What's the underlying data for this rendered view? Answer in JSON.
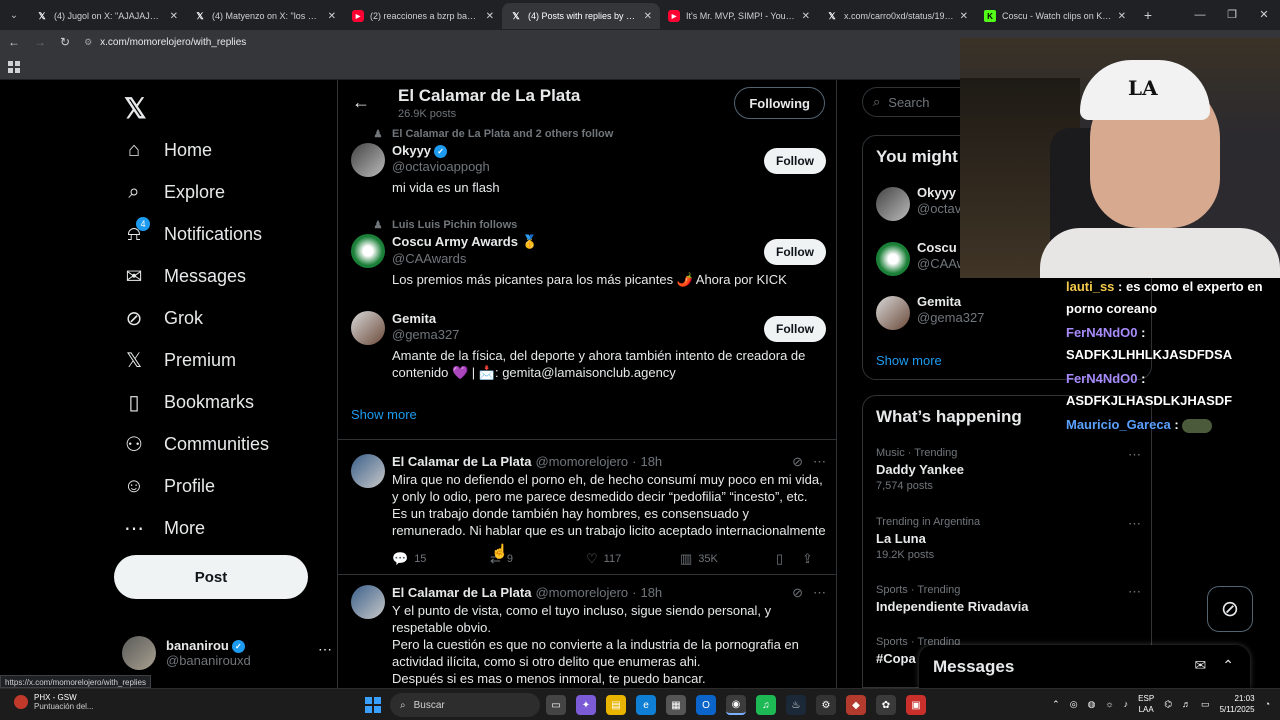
{
  "browser": {
    "tabs": [
      {
        "icon": "x",
        "title": "(4) Jugol on X: \"AJAJAJAJAJA…",
        "active": false
      },
      {
        "icon": "x",
        "title": "(4) Matyenzo on X: \"los nuevos",
        "active": false
      },
      {
        "icon": "yt",
        "title": "(2) reacciones a bzrp bananirou",
        "active": false
      },
      {
        "icon": "x",
        "title": "(4) Posts with replies by El Cala",
        "active": true
      },
      {
        "icon": "yt",
        "title": "It's Mr. MVP, SIMP! - YouTube",
        "active": false
      },
      {
        "icon": "x",
        "title": "x.com/carro0xd/status/198603",
        "active": false
      },
      {
        "icon": "kick",
        "title": "Coscu - Watch clips on Kick",
        "active": false
      }
    ],
    "url": "x.com/momorelojero/with_replies",
    "status_url": "https://x.com/momorelojero/with_replies"
  },
  "sidebar": {
    "nav": [
      {
        "label": "Home",
        "icon": "home-icon",
        "glyph": "⌂"
      },
      {
        "label": "Explore",
        "icon": "search-icon",
        "glyph": "⌕"
      },
      {
        "label": "Notifications",
        "icon": "bell-icon",
        "glyph": "⍾",
        "badge": "4"
      },
      {
        "label": "Messages",
        "icon": "envelope-icon",
        "glyph": "✉"
      },
      {
        "label": "Grok",
        "icon": "grok-icon",
        "glyph": "⊘"
      },
      {
        "label": "Premium",
        "icon": "x-premium-icon",
        "glyph": "𝕏"
      },
      {
        "label": "Bookmarks",
        "icon": "bookmark-icon",
        "glyph": "▯"
      },
      {
        "label": "Communities",
        "icon": "people-icon",
        "glyph": "⚇"
      },
      {
        "label": "Profile",
        "icon": "person-icon",
        "glyph": "☺"
      },
      {
        "label": "More",
        "icon": "more-circle-icon",
        "glyph": "⋯"
      }
    ],
    "post_label": "Post",
    "account": {
      "name": "bananirou",
      "handle": "@bananirouxd"
    }
  },
  "profile_header": {
    "name": "El Calamar de La Plata",
    "posts_count": "26.9K posts",
    "following_label": "Following"
  },
  "suggestions": [
    {
      "context": "El Calamar de La Plata and 2 others follow",
      "name": "Okyyy",
      "verified": true,
      "handle": "@octavioappogh",
      "bio": "mi vida es un flash",
      "follow_label": "Follow"
    },
    {
      "context": "Luis Luis Pichin follows",
      "name": "Coscu Army Awards 🥇",
      "verified": false,
      "handle": "@CAAwards",
      "bio": "Los premios más picantes para los más picantes 🌶️ Ahora por KICK",
      "follow_label": "Follow"
    },
    {
      "context": "",
      "name": "Gemita",
      "verified": false,
      "handle": "@gema327",
      "bio": "Amante de la física, del deporte y ahora también intento de creadora de contenido 💜 | 📩: gemita@lamaisonclub.agency",
      "follow_label": "Follow"
    }
  ],
  "show_more_label": "Show more",
  "tweets": [
    {
      "name": "El Calamar de La Plata",
      "handle": "@momorelojero",
      "time": "18h",
      "text": "Mira que no defiendo el porno eh, de hecho consumí muy poco en mi vida, y only lo odio, pero me parece desmedido decir “pedofilia” “incesto”, etc. Es un trabajo donde también hay hombres, es consensuado y remunerado. Ni hablar que es un trabajo licito aceptado internacionalmente",
      "replies": "15",
      "reposts": "9",
      "likes": "117",
      "views": "35K"
    },
    {
      "name": "El Calamar de La Plata",
      "handle": "@momorelojero",
      "time": "18h",
      "text": "Y el punto de vista, como el tuyo incluso, sigue siendo personal, y respetable obvio.\nPero la cuestión es que no convierte a la industria de la pornografia en actividad ilícita, como si otro delito que enumeras ahi.\nDespués si es mas o menos inmoral, te puedo bancar."
    }
  ],
  "right": {
    "search_placeholder": "Search",
    "who_to_follow_title": "You might like",
    "who_to_follow": [
      {
        "name": "Okyyy",
        "handle": "@octavioappogh"
      },
      {
        "name": "Coscu Army Awards",
        "handle": "@CAAwards"
      },
      {
        "name": "Gemita",
        "handle": "@gema327"
      }
    ],
    "show_more_label": "Show more",
    "whats_happening_title": "What’s happening",
    "trends": [
      {
        "category": "Music · Trending",
        "name": "Daddy Yankee",
        "count": "7,574 posts"
      },
      {
        "category": "Trending in Argentina",
        "name": "La Luna",
        "count": "19.2K posts"
      },
      {
        "category": "Sports · Trending",
        "name": "Independiente Rivadavia",
        "count": ""
      },
      {
        "category": "Sports · Trending",
        "name": "#Copa",
        "count": ""
      }
    ],
    "messages_title": "Messages"
  },
  "chat": [
    {
      "user": "lauti_ss",
      "msg": "es como el experto en porno coreano",
      "color": "#f2c94c"
    },
    {
      "user": "FerN4NdO0",
      "msg": "SADFKJLHHLKJASDFDSA",
      "color": "#a78bfa"
    },
    {
      "user": "FerN4NdO0",
      "msg": "ASDFKJLHASDLKJHASDF",
      "color": "#a78bfa"
    },
    {
      "user": "Mauricio_Gareca",
      "msg": "",
      "color": "#5aa0ff"
    }
  ],
  "taskbar": {
    "weather_title": "PHX - GSW",
    "weather_sub": "Puntuación del...",
    "search_placeholder": "Buscar",
    "lang_top": "ESP",
    "lang_bottom": "LAA",
    "time": "21:03",
    "date": "5/11/2025"
  }
}
